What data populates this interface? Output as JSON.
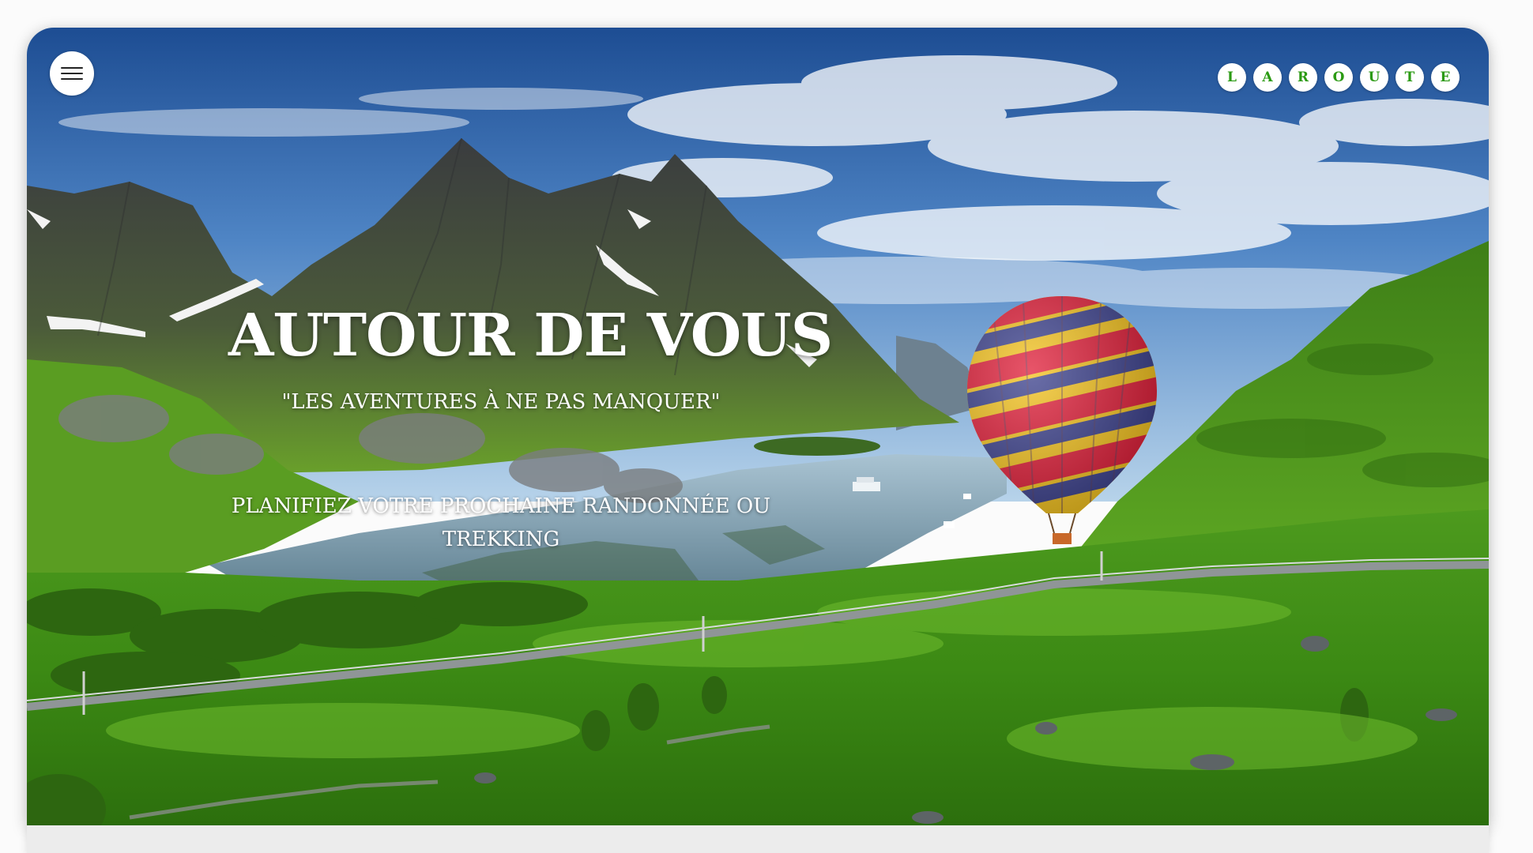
{
  "header": {
    "menu_icon": "hamburger-menu-icon",
    "logo_letters": [
      "L",
      "A",
      "R",
      "O",
      "U",
      "T",
      "E"
    ]
  },
  "hero": {
    "title": "AUTOUR DE VOUS",
    "subtitle": "\"LES AVENTURES À NE PAS MANQUER\"",
    "tagline": "PLANIFIEZ VOTRE PROCHAINE RANDONNÉE OU TREKKING"
  },
  "colors": {
    "logo_text": "#2b9a13",
    "logo_bg": "#ffffff",
    "hero_text": "#ffffff",
    "band_bg": "#ececec"
  }
}
